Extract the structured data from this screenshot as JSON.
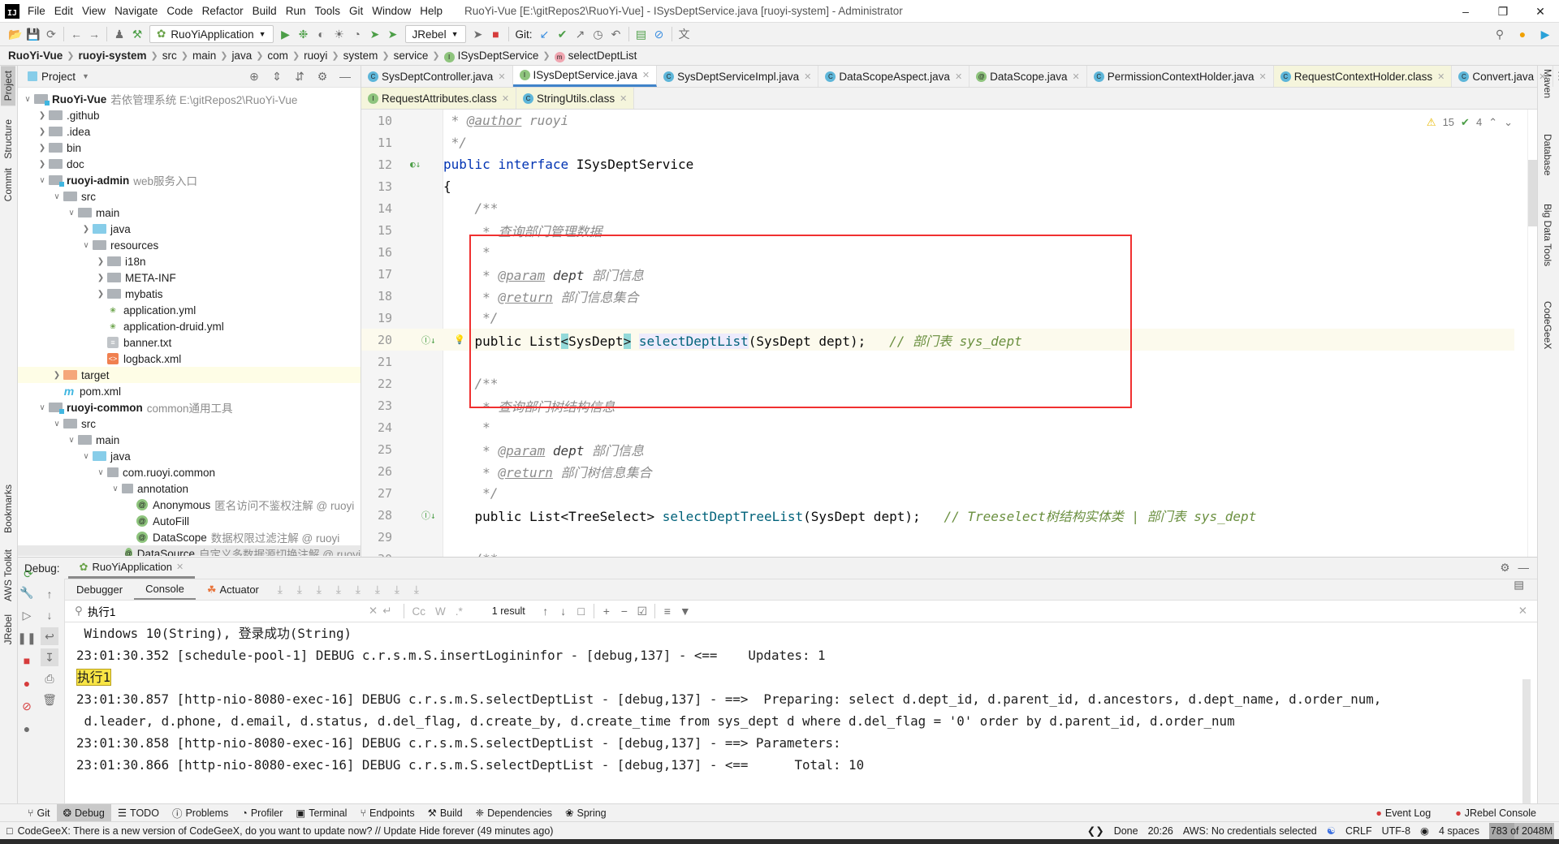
{
  "window": {
    "title": "RuoYi-Vue [E:\\gitRepos2\\RuoYi-Vue] - ISysDeptService.java [ruoyi-system] - Administrator",
    "logo": "IJ",
    "minimize": "–",
    "restore": "❐",
    "close": "✕"
  },
  "menu": [
    "File",
    "Edit",
    "View",
    "Navigate",
    "Code",
    "Refactor",
    "Build",
    "Run",
    "Tools",
    "Git",
    "Window",
    "Help"
  ],
  "toolbar": {
    "run_config": "RuoYiApplication",
    "jrebel": "JRebel",
    "git_label": "Git:"
  },
  "breadcrumb": [
    "RuoYi-Vue",
    "ruoyi-system",
    "src",
    "main",
    "java",
    "com",
    "ruoyi",
    "system",
    "service",
    "ISysDeptService",
    "selectDeptList"
  ],
  "left_strip": [
    "Project",
    "Structure",
    "Commit",
    "Bookmarks",
    "AWS Toolkit",
    "JRebel"
  ],
  "right_strip": [
    "Maven",
    "Database",
    "Big Data Tools",
    "CodeGeeX"
  ],
  "project": {
    "title": "Project",
    "tree": [
      {
        "name": "RuoYi-Vue",
        "extra": "若依管理系统  E:\\gitRepos2\\RuoYi-Vue",
        "depth": 0,
        "arrow": "open",
        "icon": "module",
        "bold": true
      },
      {
        "name": ".github",
        "depth": 1,
        "arrow": "closed",
        "icon": "folder"
      },
      {
        "name": ".idea",
        "depth": 1,
        "arrow": "closed",
        "icon": "folder"
      },
      {
        "name": "bin",
        "depth": 1,
        "arrow": "closed",
        "icon": "folder"
      },
      {
        "name": "doc",
        "depth": 1,
        "arrow": "closed",
        "icon": "folder"
      },
      {
        "name": "ruoyi-admin",
        "extra": "web服务入口",
        "depth": 1,
        "arrow": "open",
        "icon": "module",
        "bold": true
      },
      {
        "name": "src",
        "depth": 2,
        "arrow": "open",
        "icon": "folder"
      },
      {
        "name": "main",
        "depth": 3,
        "arrow": "open",
        "icon": "folder"
      },
      {
        "name": "java",
        "depth": 4,
        "arrow": "closed",
        "icon": "source"
      },
      {
        "name": "resources",
        "depth": 4,
        "arrow": "open",
        "icon": "folder"
      },
      {
        "name": "i18n",
        "depth": 5,
        "arrow": "closed",
        "icon": "folder"
      },
      {
        "name": "META-INF",
        "depth": 5,
        "arrow": "closed",
        "icon": "folder"
      },
      {
        "name": "mybatis",
        "depth": 5,
        "arrow": "closed",
        "icon": "folder"
      },
      {
        "name": "application.yml",
        "depth": 5,
        "arrow": "none",
        "icon": "spring"
      },
      {
        "name": "application-druid.yml",
        "depth": 5,
        "arrow": "none",
        "icon": "spring"
      },
      {
        "name": "banner.txt",
        "depth": 5,
        "arrow": "none",
        "icon": "text"
      },
      {
        "name": "logback.xml",
        "depth": 5,
        "arrow": "none",
        "icon": "xml"
      },
      {
        "name": "target",
        "depth": 2,
        "arrow": "closed",
        "icon": "excluded",
        "highlight": true
      },
      {
        "name": "pom.xml",
        "depth": 2,
        "arrow": "none",
        "icon": "maven"
      },
      {
        "name": "ruoyi-common",
        "extra": "common通用工具",
        "depth": 1,
        "arrow": "open",
        "icon": "module",
        "bold": true
      },
      {
        "name": "src",
        "depth": 2,
        "arrow": "open",
        "icon": "folder"
      },
      {
        "name": "main",
        "depth": 3,
        "arrow": "open",
        "icon": "folder"
      },
      {
        "name": "java",
        "depth": 4,
        "arrow": "open",
        "icon": "source"
      },
      {
        "name": "com.ruoyi.common",
        "depth": 5,
        "arrow": "open",
        "icon": "package"
      },
      {
        "name": "annotation",
        "depth": 6,
        "arrow": "open",
        "icon": "package"
      },
      {
        "name": "Anonymous",
        "extra": "匿名访问不鉴权注解 @ ruoyi",
        "depth": 7,
        "arrow": "none",
        "icon": "annotation"
      },
      {
        "name": "AutoFill",
        "depth": 7,
        "arrow": "none",
        "icon": "annotation"
      },
      {
        "name": "DataScope",
        "extra": "数据权限过滤注解 @ ruoyi",
        "depth": 7,
        "arrow": "none",
        "icon": "annotation"
      },
      {
        "name": "DataSource",
        "extra": "自定义多数据源切换注解 @ ruoyi",
        "depth": 7,
        "arrow": "none",
        "icon": "annotation",
        "selected": true
      }
    ]
  },
  "editor": {
    "tabs_row1": [
      {
        "label": "SysDeptController.java",
        "icon": "c"
      },
      {
        "label": "ISysDeptService.java",
        "icon": "i",
        "active": true
      },
      {
        "label": "SysDeptServiceImpl.java",
        "icon": "c"
      },
      {
        "label": "DataScopeAspect.java",
        "icon": "c"
      },
      {
        "label": "DataScope.java",
        "icon": "a"
      },
      {
        "label": "PermissionContextHolder.java",
        "icon": "c"
      },
      {
        "label": "RequestContextHolder.class",
        "icon": "c",
        "readonly": true
      },
      {
        "label": "Convert.java",
        "icon": "c"
      }
    ],
    "tabs_row2": [
      {
        "label": "RequestAttributes.class",
        "icon": "i",
        "readonly": true
      },
      {
        "label": "StringUtils.class",
        "icon": "c",
        "readonly": true
      }
    ],
    "inspections": {
      "warnings": "15",
      "weak_warnings": "4"
    },
    "current_line": 20,
    "lines": [
      {
        "n": "10",
        "t": [
          [
            "doc",
            " * "
          ],
          [
            "tag",
            "@author"
          ],
          [
            "doc",
            " ruoyi"
          ]
        ]
      },
      {
        "n": "11",
        "t": [
          [
            "doc",
            " */"
          ]
        ]
      },
      {
        "n": "12",
        "t": [
          [
            "kw",
            "public"
          ],
          [
            "pl",
            " "
          ],
          [
            "kw",
            "interface"
          ],
          [
            "pl",
            " ISysDeptService"
          ]
        ],
        "gutter": "impl"
      },
      {
        "n": "13",
        "t": [
          [
            "pl",
            "{"
          ]
        ]
      },
      {
        "n": "14",
        "t": [
          [
            "doc",
            "    /**"
          ]
        ]
      },
      {
        "n": "15",
        "t": [
          [
            "doc",
            "     * 查询部门管理数据"
          ]
        ]
      },
      {
        "n": "16",
        "t": [
          [
            "doc",
            "     *"
          ]
        ]
      },
      {
        "n": "17",
        "t": [
          [
            "doc",
            "     * "
          ],
          [
            "tag",
            "@param"
          ],
          [
            "param",
            " dept"
          ],
          [
            "doc",
            " 部门信息"
          ]
        ]
      },
      {
        "n": "18",
        "t": [
          [
            "doc",
            "     * "
          ],
          [
            "tag",
            "@return"
          ],
          [
            "doc",
            " 部门信息集合"
          ]
        ]
      },
      {
        "n": "19",
        "t": [
          [
            "doc",
            "     */"
          ]
        ]
      },
      {
        "n": "20",
        "t": [
          [
            "pl",
            "    public List"
          ],
          [
            "br",
            "<"
          ],
          [
            "pl",
            "SysDept"
          ],
          [
            "br",
            ">"
          ],
          [
            "pl",
            " "
          ],
          [
            "hm",
            "selectDeptList"
          ],
          [
            "pl",
            "(SysDept dept);   "
          ],
          [
            "cm",
            "// 部门表 sys_dept"
          ]
        ],
        "gutter": "down",
        "bulb": true
      },
      {
        "n": "21",
        "t": []
      },
      {
        "n": "22",
        "t": [
          [
            "doc",
            "    /**"
          ]
        ]
      },
      {
        "n": "23",
        "t": [
          [
            "doc",
            "     * 查询部门树结构信息"
          ]
        ]
      },
      {
        "n": "24",
        "t": [
          [
            "doc",
            "     *"
          ]
        ]
      },
      {
        "n": "25",
        "t": [
          [
            "doc",
            "     * "
          ],
          [
            "tag",
            "@param"
          ],
          [
            "param",
            " dept"
          ],
          [
            "doc",
            " 部门信息"
          ]
        ]
      },
      {
        "n": "26",
        "t": [
          [
            "doc",
            "     * "
          ],
          [
            "tag",
            "@return"
          ],
          [
            "doc",
            " 部门树信息集合"
          ]
        ]
      },
      {
        "n": "27",
        "t": [
          [
            "doc",
            "     */"
          ]
        ]
      },
      {
        "n": "28",
        "t": [
          [
            "pl",
            "    public List<TreeSelect> "
          ],
          [
            "me",
            "selectDeptTreeList"
          ],
          [
            "pl",
            "(SysDept dept);   "
          ],
          [
            "cm",
            "// Treeselect树结构实体类 | 部门表 sys_dept"
          ]
        ],
        "gutter": "down"
      },
      {
        "n": "29",
        "t": []
      },
      {
        "n": "30",
        "t": [
          [
            "doc",
            "    /**"
          ]
        ]
      }
    ]
  },
  "debug": {
    "label": "Debug:",
    "session": "RuoYiApplication",
    "tabs": [
      "Debugger",
      "Console",
      "Actuator"
    ],
    "active_tab": "Console",
    "search": {
      "value": "执行1",
      "result": "1 result",
      "case": "Cc",
      "words": "W",
      "regex": ".*"
    },
    "console": [
      " Windows 10(String), 登录成功(String)",
      "23:01:30.352 [schedule-pool-1] DEBUG c.r.s.m.S.insertLogininfor - [debug,137] - <==    Updates: 1",
      "执行1",
      "23:01:30.857 [http-nio-8080-exec-16] DEBUG c.r.s.m.S.selectDeptList - [debug,137] - ==>  Preparing: select d.dept_id, d.parent_id, d.ancestors, d.dept_name, d.order_num,",
      " d.leader, d.phone, d.email, d.status, d.del_flag, d.create_by, d.create_time from sys_dept d where d.del_flag = '0' order by d.parent_id, d.order_num",
      "23:01:30.858 [http-nio-8080-exec-16] DEBUG c.r.s.m.S.selectDeptList - [debug,137] - ==> Parameters: ",
      "23:01:30.866 [http-nio-8080-exec-16] DEBUG c.r.s.m.S.selectDeptList - [debug,137] - <==      Total: 10"
    ],
    "search_hit_line": 2
  },
  "bottom_tools": [
    "Git",
    "Debug",
    "TODO",
    "Problems",
    "Profiler",
    "Terminal",
    "Endpoints",
    "Build",
    "Dependencies",
    "Spring"
  ],
  "bottom_active": "Debug",
  "bottom_right": [
    "Event Log",
    "JRebel Console"
  ],
  "status": {
    "message": "CodeGeeX: There is a new version of CodeGeeX, do you want to update now? // Update   Hide forever (49 minutes ago)",
    "done": "Done",
    "position": "20:26",
    "aws": "AWS: No credentials selected",
    "line_sep": "CRLF",
    "encoding": "UTF-8",
    "indent": "4 spaces",
    "memory": "783 of 2048M",
    "memory_used_fraction": 0.382
  },
  "colors": {
    "accent": "#4083c9",
    "highlight_box": "#f03030",
    "search_hit": "#f8e545"
  }
}
